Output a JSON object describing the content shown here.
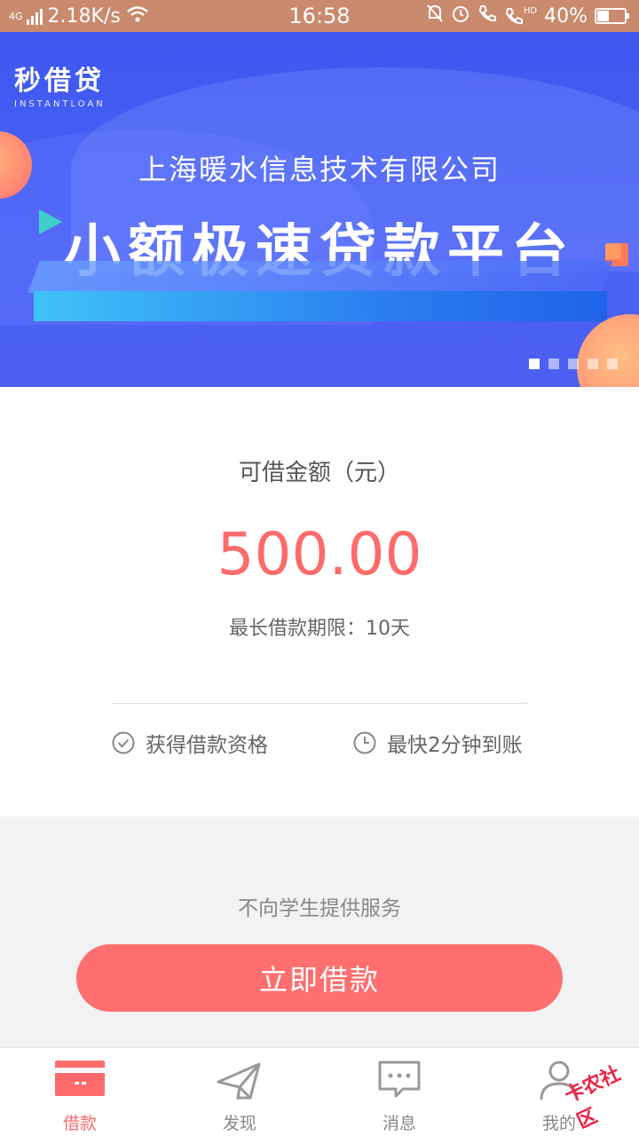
{
  "status_bar": {
    "network": "4G",
    "speed": "2.18K/s",
    "time": "16:58",
    "hd": "HD",
    "battery": "40%",
    "battery_level": 0.4
  },
  "banner": {
    "logo_cn": "秒借贷",
    "logo_en": "INSTANTLOAN",
    "subtitle": "上海暖水信息技术有限公司",
    "title": "小额极速贷款平台",
    "slides": 5,
    "active_slide": 0
  },
  "loan": {
    "amount_label": "可借金额（元）",
    "amount": "500.00",
    "term": "最长借款期限：10天",
    "feature_1": "获得借款资格",
    "feature_2": "最快2分钟到账"
  },
  "notice": "不向学生提供服务",
  "cta": "立即借款",
  "nav": {
    "items": [
      {
        "label": "借款",
        "icon": "card-icon"
      },
      {
        "label": "发现",
        "icon": "paper-plane-icon"
      },
      {
        "label": "消息",
        "icon": "message-icon"
      },
      {
        "label": "我的",
        "icon": "user-icon"
      }
    ],
    "active": 0
  },
  "watermark": "卡农社区",
  "colors": {
    "accent": "#ff6b6b",
    "banner": "#4a63f5",
    "status_bar": "#c98a6d"
  }
}
